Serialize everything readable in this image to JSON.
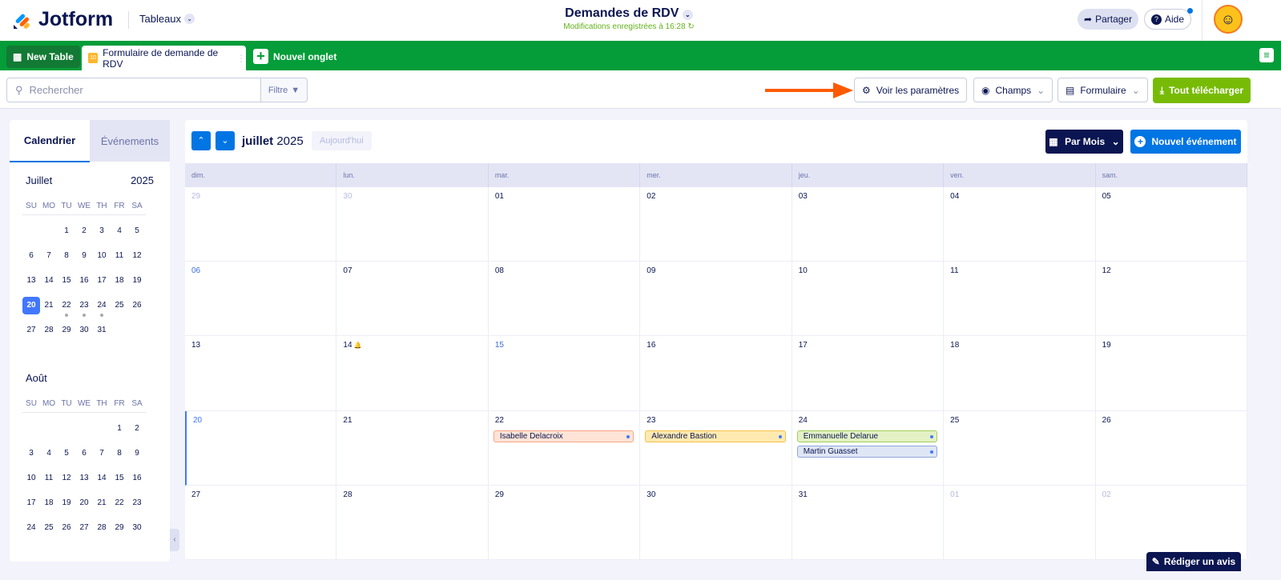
{
  "header": {
    "brand": "Jotform",
    "menu": "Tableaux",
    "title": "Demandes de RDV",
    "saved": "Modifications enregistrées à 16:28",
    "share": "Partager",
    "help": "Aide"
  },
  "tabs": {
    "new_table": "New Table",
    "form_tab": "Formulaire de demande de RDV",
    "add_tab": "Nouvel onglet"
  },
  "toolbar": {
    "search_placeholder": "Rechercher",
    "filter": "Filtre",
    "settings": "Voir les paramètres",
    "fields": "Champs",
    "form": "Formulaire",
    "download": "Tout télécharger"
  },
  "sidebar": {
    "tab_calendar": "Calendrier",
    "tab_events": "Événements",
    "months": [
      {
        "name": "Juillet",
        "year": "2025",
        "weekdays": [
          "SU",
          "MO",
          "TU",
          "WE",
          "TH",
          "FR",
          "SA"
        ],
        "offset": 2,
        "days": 31,
        "selected": 20,
        "event_days": [
          22,
          23,
          24
        ]
      },
      {
        "name": "Août",
        "year": "",
        "weekdays": [
          "SU",
          "MO",
          "TU",
          "WE",
          "TH",
          "FR",
          "SA"
        ],
        "offset": 5,
        "days": 30,
        "selected": null,
        "event_days": []
      }
    ]
  },
  "calendar": {
    "month": "juillet",
    "year": "2025",
    "today": "Aujourd'hui",
    "view": "Par Mois",
    "new_event": "Nouvel événement",
    "weekdays": [
      "dim.",
      "lun.",
      "mar.",
      "mer.",
      "jeu.",
      "ven.",
      "sam."
    ],
    "days": [
      "29",
      "30",
      "01",
      "02",
      "03",
      "04",
      "05",
      "06",
      "07",
      "08",
      "09",
      "10",
      "11",
      "12",
      "13",
      "14",
      "15",
      "16",
      "17",
      "18",
      "19",
      "20",
      "21",
      "22",
      "23",
      "24",
      "25",
      "26",
      "27",
      "28",
      "29",
      "30",
      "31",
      "01",
      "02"
    ],
    "other_month_indices": [
      0,
      1,
      33,
      34
    ],
    "today_index": 21,
    "highlight_indices": [
      7,
      16,
      21
    ],
    "bell_index": 15,
    "events": [
      {
        "index": 23,
        "name": "Isabelle Delacroix",
        "color": "#fde4d6",
        "border": "#f7a688"
      },
      {
        "index": 24,
        "name": "Alexandre Bastion",
        "color": "#feeab0",
        "border": "#f5c04a"
      },
      {
        "index": 25,
        "name": "Emmanuelle Delarue",
        "color": "#e3f1c4",
        "border": "#a4cf5a"
      },
      {
        "index": 25,
        "name": "Martin Guasset",
        "color": "#dfe6f5",
        "border": "#8ea7d8"
      }
    ]
  },
  "footer": {
    "review": "Rédiger un avis"
  }
}
